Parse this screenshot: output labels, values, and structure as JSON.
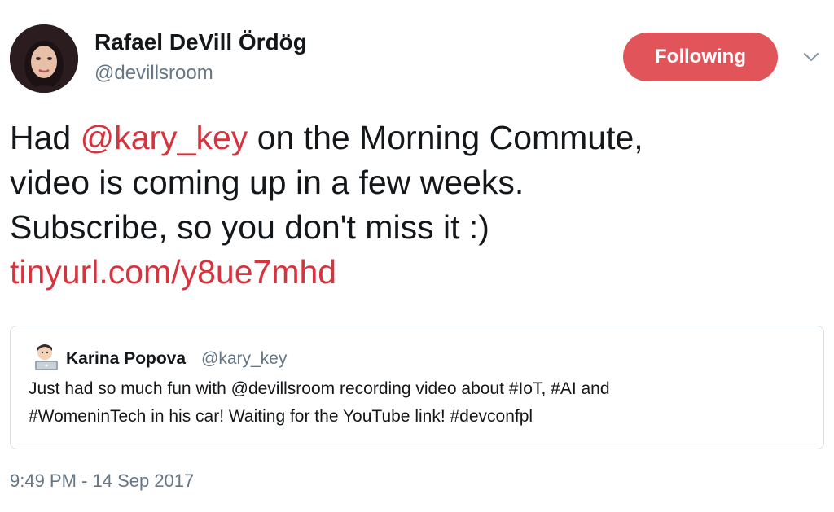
{
  "author": {
    "display_name": "Rafael DeVill Ördög",
    "handle": "@devillsroom",
    "avatar_icon": "profile-photo"
  },
  "follow_button": {
    "label": "Following",
    "color": "#e0545a"
  },
  "menu": {
    "icon": "chevron-down-icon"
  },
  "tweet": {
    "line1_pre": "Had ",
    "mention": "@kary_key",
    "line1_post": " on the Morning Commute,",
    "line2": "video is coming up in a few weeks.",
    "line3": "Subscribe, so you don't miss it :)",
    "link": "tinyurl.com/y8ue7mhd",
    "link_color": "#d6333e"
  },
  "quoted_tweet": {
    "author_name": "Karina Popova",
    "author_handle": "@kary_key",
    "avatar_icon": "woman-technologist-emoji",
    "text_line1": "Just had so much fun with @devillsroom recording video about #IoT, #AI and",
    "text_line2": "#WomeninTech in his car! Waiting for the YouTube link! #devconfpl"
  },
  "timestamp": "9:49 PM - 14 Sep 2017"
}
